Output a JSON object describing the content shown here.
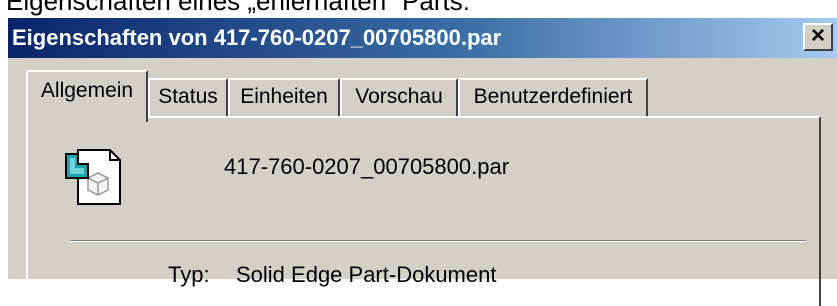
{
  "heading": "Eigenschaften eines „ehlerhaften“ Parts:",
  "window": {
    "title": "Eigenschaften von 417-760-0207_00705800.par",
    "close_label": "×"
  },
  "tabs": [
    {
      "label": "Allgemein",
      "active": true
    },
    {
      "label": "Status",
      "active": false
    },
    {
      "label": "Einheiten",
      "active": false
    },
    {
      "label": "Vorschau",
      "active": false
    },
    {
      "label": "Benutzerdefiniert",
      "active": false
    }
  ],
  "general": {
    "file_icon": "solid-edge-part-icon",
    "filename": "417-760-0207_00705800.par",
    "type_label": "Typ:",
    "type_value": "Solid Edge Part-Dokument"
  }
}
